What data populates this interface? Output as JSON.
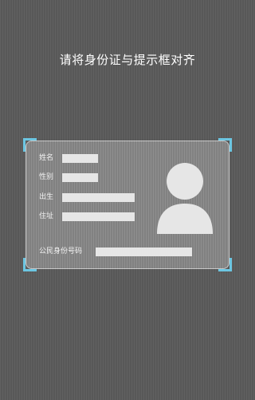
{
  "instruction": "请将身份证与提示框对齐",
  "card": {
    "fields": {
      "name_label": "姓名",
      "gender_label": "性别",
      "birth_label": "出生",
      "address_label": "住址",
      "id_number_label": "公民身份号码"
    },
    "avatar_icon": "person-silhouette-icon"
  },
  "colors": {
    "frame_corner": "#6cc6e2",
    "background": "#5b5b5b",
    "placeholder_bar": "#e6e6e6",
    "text": "#ffffff"
  }
}
